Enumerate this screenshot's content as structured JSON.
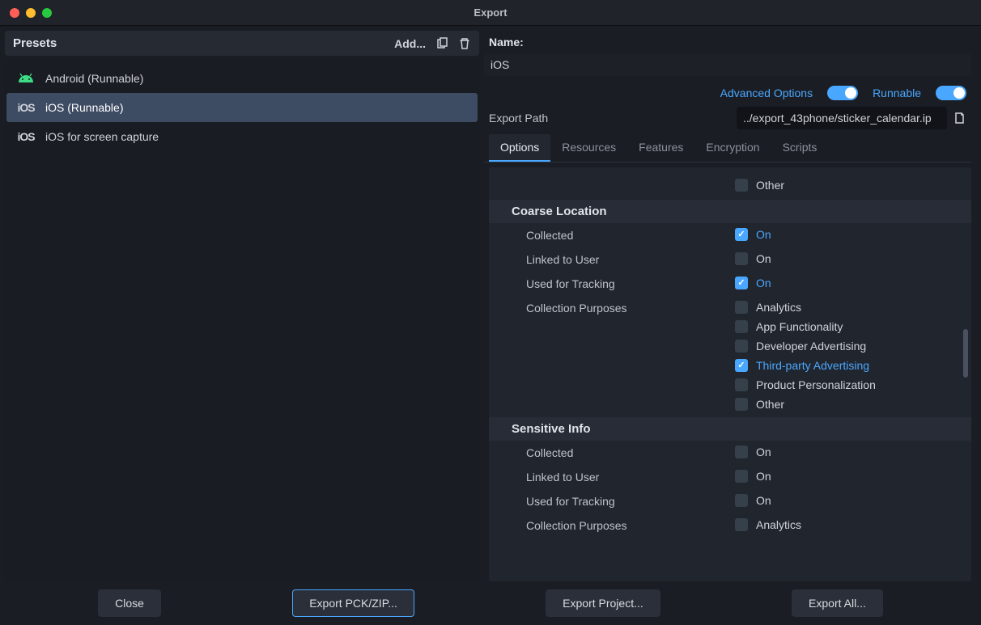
{
  "window_title": "Export",
  "presets_header": "Presets",
  "add_label": "Add...",
  "presets": [
    {
      "label": "Android (Runnable)",
      "platform": "android"
    },
    {
      "label": "iOS (Runnable)",
      "platform": "ios",
      "selected": true
    },
    {
      "label": "iOS for screen capture",
      "platform": "ios"
    }
  ],
  "name_label": "Name:",
  "name_value": "iOS",
  "toggles": {
    "advanced_label": "Advanced Options",
    "runnable_label": "Runnable"
  },
  "export_path_label": "Export Path",
  "export_path_value": "../export_43phone/sticker_calendar.ip",
  "tabs": [
    "Options",
    "Resources",
    "Features",
    "Encryption",
    "Scripts"
  ],
  "active_tab": 0,
  "sections": [
    {
      "pre_items": [
        {
          "label": "",
          "values": [
            {
              "text": "Other",
              "checked": false
            }
          ]
        }
      ],
      "title": "Coarse Location",
      "items": [
        {
          "label": "Collected",
          "values": [
            {
              "text": "On",
              "checked": true
            }
          ]
        },
        {
          "label": "Linked to User",
          "values": [
            {
              "text": "On",
              "checked": false
            }
          ]
        },
        {
          "label": "Used for Tracking",
          "values": [
            {
              "text": "On",
              "checked": true
            }
          ]
        },
        {
          "label": "Collection Purposes",
          "values": [
            {
              "text": "Analytics",
              "checked": false
            },
            {
              "text": "App Functionality",
              "checked": false
            },
            {
              "text": "Developer Advertising",
              "checked": false
            },
            {
              "text": "Third-party Advertising",
              "checked": true
            },
            {
              "text": "Product Personalization",
              "checked": false
            },
            {
              "text": "Other",
              "checked": false
            }
          ]
        }
      ]
    },
    {
      "title": "Sensitive Info",
      "items": [
        {
          "label": "Collected",
          "values": [
            {
              "text": "On",
              "checked": false
            }
          ]
        },
        {
          "label": "Linked to User",
          "values": [
            {
              "text": "On",
              "checked": false
            }
          ]
        },
        {
          "label": "Used for Tracking",
          "values": [
            {
              "text": "On",
              "checked": false
            }
          ]
        },
        {
          "label": "Collection Purposes",
          "values": [
            {
              "text": "Analytics",
              "checked": false
            }
          ]
        }
      ]
    }
  ],
  "footer": {
    "close": "Close",
    "export_pck": "Export PCK/ZIP...",
    "export_project": "Export Project...",
    "export_all": "Export All..."
  }
}
